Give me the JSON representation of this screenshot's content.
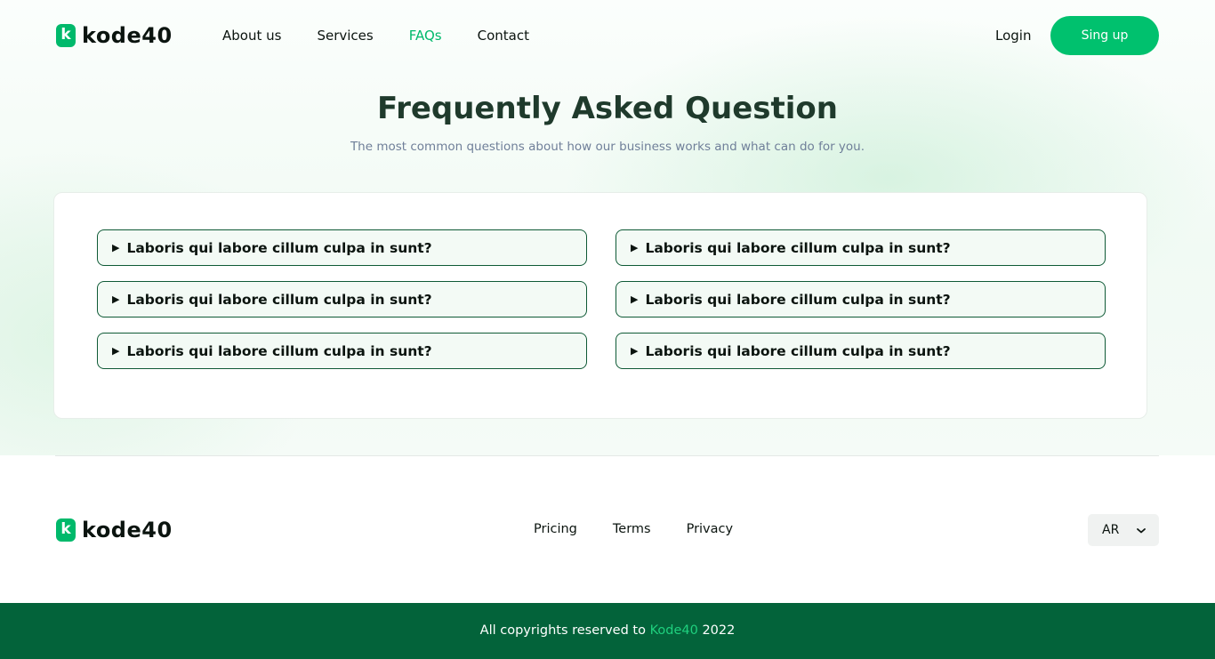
{
  "header": {
    "logo_letter": "k",
    "logo_text": "kode40",
    "nav": [
      {
        "label": "About us",
        "active": false
      },
      {
        "label": "Services",
        "active": false
      },
      {
        "label": "FAQs",
        "active": true
      },
      {
        "label": "Contact",
        "active": false
      }
    ],
    "login_label": "Login",
    "signup_label": "Sing up"
  },
  "faq": {
    "title": "Frequently Asked Question",
    "subtitle": "The most common questions about how our business works and what can do for you.",
    "questions": [
      "Laboris qui labore cillum culpa in sunt?",
      "Laboris qui labore cillum culpa in sunt?",
      "Laboris qui labore cillum culpa in sunt?",
      "Laboris qui labore cillum culpa in sunt?",
      "Laboris qui labore cillum culpa in sunt?",
      "Laboris qui labore cillum culpa in sunt?"
    ]
  },
  "footer": {
    "logo_letter": "k",
    "logo_text": "kode40",
    "links": [
      "Pricing",
      "Terms",
      "Privacy"
    ],
    "language": "AR",
    "copyright_prefix": "All copyrights reserved to",
    "copyright_brand": "Kode40",
    "copyright_year": "2022"
  },
  "colors": {
    "accent": "#00c16e",
    "dark_green": "#03633a",
    "faq_border": "#0f5a36"
  },
  "icons": {
    "faq_marker": "triangle-right-icon",
    "language_toggle": "chevron-down-icon"
  }
}
